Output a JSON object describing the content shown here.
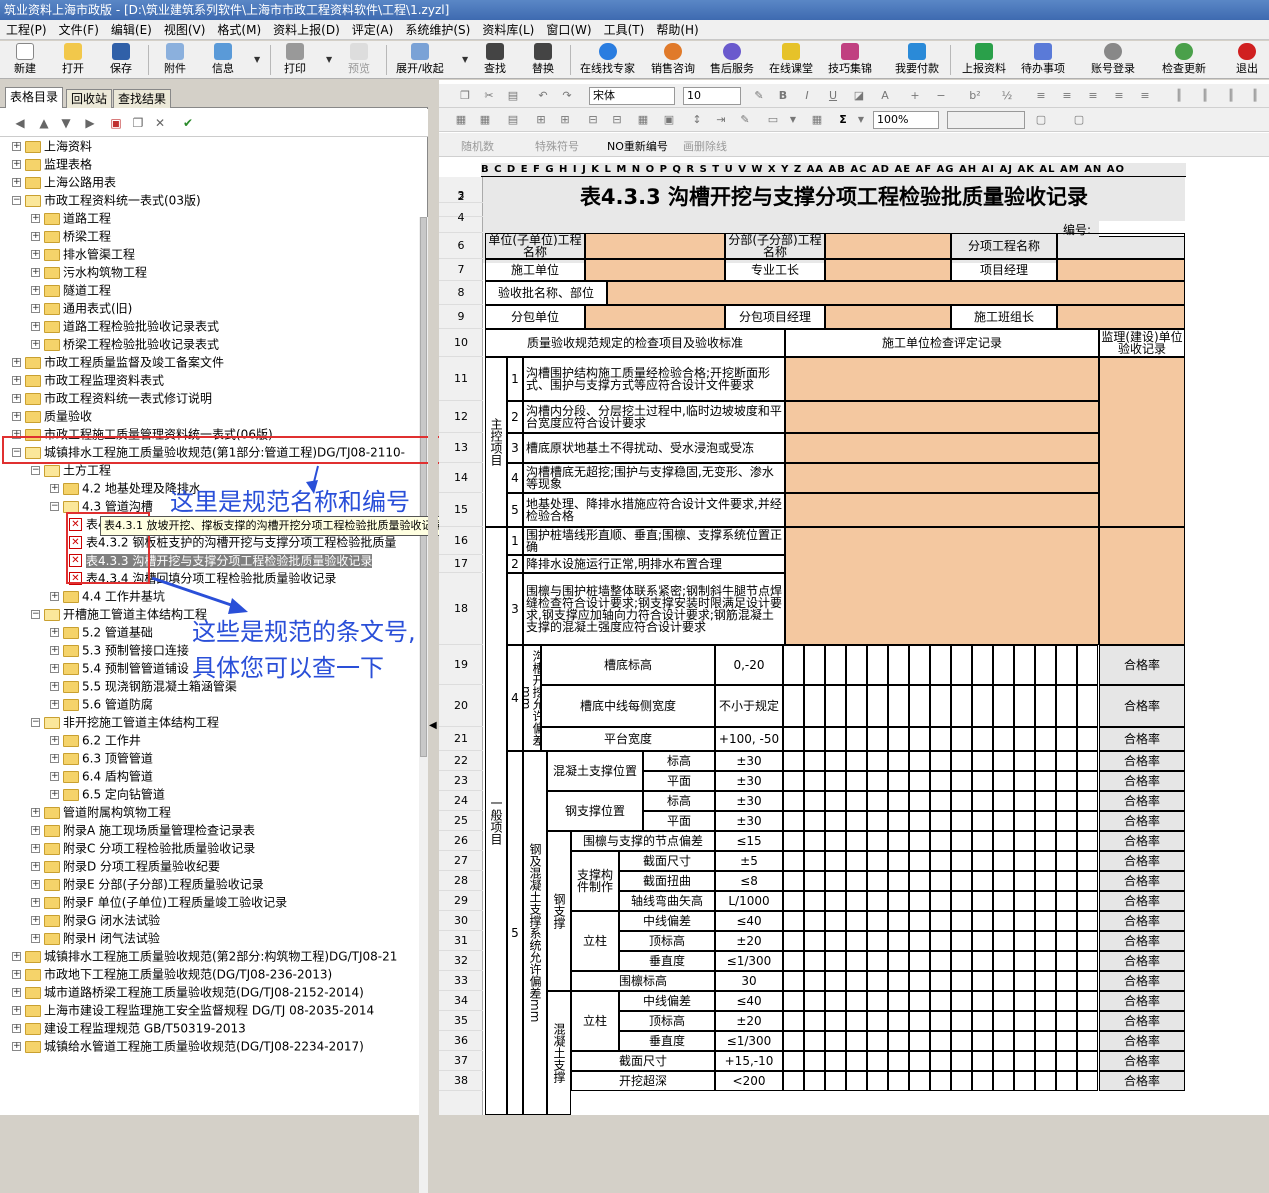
{
  "window": {
    "title": "筑业资料上海市政版 - [D:\\筑业建筑系列软件\\上海市市政工程资料软件\\工程\\1.zyzl]"
  },
  "menu": [
    "工程(P)",
    "文件(F)",
    "编辑(E)",
    "视图(V)",
    "格式(M)",
    "资料上报(D)",
    "评定(A)",
    "系统维护(S)",
    "资料库(L)",
    "窗口(W)",
    "工具(T)",
    "帮助(H)"
  ],
  "toolbar": {
    "new": "新建",
    "open": "打开",
    "save": "保存",
    "attach": "附件",
    "info": "信息",
    "print": "打印",
    "preview": "预览",
    "expand": "展开/收起",
    "find": "查找",
    "replace": "替换",
    "expert": "在线找专家",
    "sales": "销售咨询",
    "service": "售后服务",
    "course": "在线课堂",
    "tips": "技巧集锦",
    "pay": "我要付款",
    "upload": "上报资料",
    "todo": "待办事项",
    "login": "账号登录",
    "update": "检查更新",
    "exit": "退出"
  },
  "left_tabs": [
    "表格目录",
    "回收站",
    "查找结果"
  ],
  "tree": [
    {
      "t": "上海资料",
      "d": 0
    },
    {
      "t": "监理表格",
      "d": 0
    },
    {
      "t": "上海公路用表",
      "d": 0
    },
    {
      "t": "市政工程资料统一表式(03版)",
      "d": 0,
      "o": true
    },
    {
      "t": "道路工程",
      "d": 1
    },
    {
      "t": "桥梁工程",
      "d": 1
    },
    {
      "t": "排水管渠工程",
      "d": 1
    },
    {
      "t": "污水构筑物工程",
      "d": 1
    },
    {
      "t": "隧道工程",
      "d": 1
    },
    {
      "t": "通用表式(旧)",
      "d": 1
    },
    {
      "t": "道路工程检验批验收记录表式",
      "d": 1
    },
    {
      "t": "桥梁工程检验批验收记录表式",
      "d": 1
    },
    {
      "t": "市政工程质量监督及竣工备案文件",
      "d": 0
    },
    {
      "t": "市政工程监理资料表式",
      "d": 0
    },
    {
      "t": "市政工程资料统一表式修订说明",
      "d": 0
    },
    {
      "t": "质量验收",
      "d": 0
    },
    {
      "t": "市政工程施工质量管理资料统一表式(06版)",
      "d": 0
    },
    {
      "t": "城镇排水工程施工质量验收规范(第1部分:管道工程)DG/TJ08-2110-",
      "d": 0,
      "o": true
    },
    {
      "t": "土方工程",
      "d": 1,
      "o": true
    },
    {
      "t": "4.2 地基处理及降排水",
      "d": 2
    },
    {
      "t": "4.3 管道沟槽",
      "d": 2,
      "o": true
    },
    {
      "t": "表4.3.1 放坡开挖沟槽分项工程检验批质量验收记录",
      "d": 3,
      "doc": true
    },
    {
      "t": "表4.3.2 钢板桩支护的沟槽开挖与支撑分项工程检验批质量",
      "d": 3,
      "doc": true
    },
    {
      "t": "表4.3.3 沟槽开挖与支撑分项工程检验批质量验收记录",
      "d": 3,
      "doc": true,
      "sel": true
    },
    {
      "t": "表4.3.4 沟槽回填分项工程检验批质量验收记录",
      "d": 3,
      "doc": true
    },
    {
      "t": "4.4 工作井基坑",
      "d": 2
    },
    {
      "t": "开槽施工管道主体结构工程",
      "d": 1,
      "o": true
    },
    {
      "t": "5.2 管道基础",
      "d": 2
    },
    {
      "t": "5.3 预制管接口连接",
      "d": 2
    },
    {
      "t": "5.4 预制管管道铺设",
      "d": 2
    },
    {
      "t": "5.5 现浇钢筋混凝土箱涵管渠",
      "d": 2
    },
    {
      "t": "5.6 管道防腐",
      "d": 2
    },
    {
      "t": "非开挖施工管道主体结构工程",
      "d": 1,
      "o": true
    },
    {
      "t": "6.2 工作井",
      "d": 2
    },
    {
      "t": "6.3 顶管管道",
      "d": 2
    },
    {
      "t": "6.4 盾构管道",
      "d": 2
    },
    {
      "t": "6.5 定向钻管道",
      "d": 2
    },
    {
      "t": "管道附属构筑物工程",
      "d": 1
    },
    {
      "t": "附录A 施工现场质量管理检查记录表",
      "d": 1
    },
    {
      "t": "附录C 分项工程检验批质量验收记录",
      "d": 1
    },
    {
      "t": "附录D 分项工程质量验收纪要",
      "d": 1
    },
    {
      "t": "附录E 分部(子分部)工程质量验收记录",
      "d": 1
    },
    {
      "t": "附录F 单位(子单位)工程质量竣工验收记录",
      "d": 1
    },
    {
      "t": "附录G 闭水法试验",
      "d": 1
    },
    {
      "t": "附录H 闭气法试验",
      "d": 1
    },
    {
      "t": "城镇排水工程施工质量验收规范(第2部分:构筑物工程)DG/TJ08-21",
      "d": 0
    },
    {
      "t": "市政地下工程施工质量验收规范(DG/TJ08-236-2013)",
      "d": 0
    },
    {
      "t": "城市道路桥梁工程施工质量验收规范(DG/TJ08-2152-2014)",
      "d": 0
    },
    {
      "t": "上海市建设工程监理施工安全监督规程 DG/TJ 08-2035-2014",
      "d": 0
    },
    {
      "t": "建设工程监理规范 GB/T50319-2013",
      "d": 0
    },
    {
      "t": "城镇给水管道工程施工质量验收规范(DG/TJ08-2234-2017)",
      "d": 0
    }
  ],
  "tooltip": "表4.3.1 放坡开挖、撑板支撑的沟槽开挖分项工程检验批质量验收记录",
  "annotations": {
    "a1": "这里是规范名称和编号",
    "a2": "这些是规范的条文号,",
    "a3": "具体您可以查一下"
  },
  "editor": {
    "font": "宋体",
    "size": "10",
    "zoom": "100%",
    "b1": "随机数",
    "b2": "特殊符号",
    "b3": "NO重新编号",
    "b4": "画删除线"
  },
  "col_letters": "B C D E F G H I J K L M N O P Q R  S T U V W X Y Z AA AB AC AD AE AF AG AH AI AJ AK AL AM AN AO",
  "rows": [
    "2",
    "3",
    "4",
    "6",
    "7",
    "8",
    "9",
    "10",
    "11",
    "12",
    "13",
    "14",
    "15",
    "16",
    "17",
    "18",
    "19",
    "20",
    "21",
    "22",
    "23",
    "24",
    "25",
    "26",
    "27",
    "28",
    "29",
    "30",
    "31",
    "32",
    "33",
    "34",
    "35",
    "36",
    "37",
    "38"
  ],
  "sheet": {
    "title": "表4.3.3 沟槽开挖与支撑分项工程检验批质量验收记录",
    "no_label": "编号:",
    "unit_name": "单位(子单位)工程名称",
    "sub_name": "分部(子分部)工程名称",
    "item_name": "分项工程名称",
    "contractor": "施工单位",
    "pro_chief": "专业工长",
    "pm": "项目经理",
    "batch": "验收批名称、部位",
    "subcon": "分包单位",
    "subpm": "分包项目经理",
    "team": "施工班组长",
    "hdr_std": "质量验收规范规定的检查项目及验收标准",
    "hdr_rec": "施工单位检查评定记录",
    "hdr_sup": "监理(建设)单位验收记录",
    "main": "主控项目",
    "m1": "沟槽围护结构施工质量经检验合格;开挖断面形式、围护与支撑方式等应符合设计文件要求",
    "m2": "沟槽内分段、分层挖土过程中,临时边坡坡度和平台宽度应符合设计要求",
    "m3": "槽底原状地基土不得扰动、受水浸泡或受冻",
    "m4": "沟槽槽底无超挖;围护与支撑稳固,无变形、渗水等现象",
    "m5": "地基处理、降排水措施应符合设计文件要求,并经检验合格",
    "g1": "围护桩墙线形直顺、垂直;围檩、支撑系统位置正确",
    "g2": "降排水设施运行正常,明排水布置合理",
    "g3": "围檩与围护桩墙整体联系紧密;钢制斜牛腿节点焊缝检查符合设计要求;钢支撑安装时限满足设计要求,钢支撑应加轴向力符合设计要求;钢筋混凝土支撑的混凝土强度应符合设计要求",
    "general": "一般项目",
    "g4": "沟槽开挖允许偏差mm",
    "bottom_el": "槽底标高",
    "bottom_el_v": "0,-20",
    "half_w": "槽底中线每侧宽度",
    "half_w_v": "不小于规定",
    "plat": "平台宽度",
    "plat_v": "+100, -50",
    "rate": "合格率",
    "g5": "钢及混凝土支撑系统允许偏差mm",
    "conc_pos": "混凝土支撑位置",
    "steel_pos": "钢支撑位置",
    "elev": "标高",
    "plane": "平面",
    "pm30": "±30",
    "node": "围檩与支撑的节点偏差",
    "node_v": "≤15",
    "steel_sup": "钢支撑",
    "fab": "支撑构件制作",
    "sect": "截面尺寸",
    "sect_v": "±5",
    "twist": "截面扭曲",
    "twist_v": "≤8",
    "bend": "轴线弯曲矢高",
    "bend_v": "L/1000",
    "col": "立柱",
    "cdev": "中线偏差",
    "cdev_v": "≤40",
    "top": "顶标高",
    "top_v": "±20",
    "vert": "垂直度",
    "vert_v": "≤1/300",
    "wale": "围檩标高",
    "wale_v": "30",
    "conc_sup": "混凝土支撑",
    "sect2_v": "+15,-10",
    "over": "开挖超深",
    "over_v": "<200"
  }
}
